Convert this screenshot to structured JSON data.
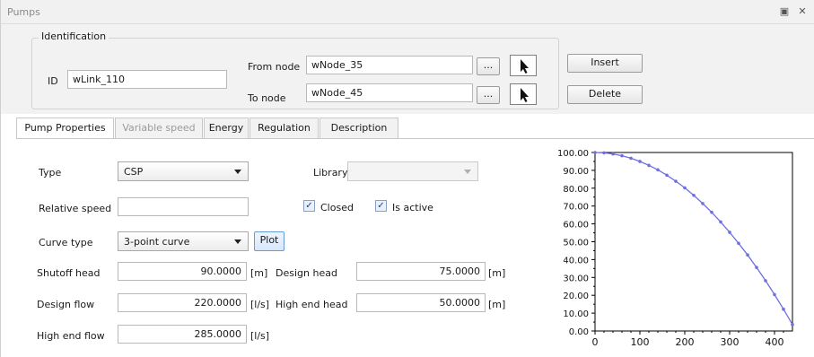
{
  "window": {
    "title": "Pumps"
  },
  "identification": {
    "legend": "Identification",
    "id_label": "ID",
    "id_value": "wLink_110",
    "from_node_label": "From node",
    "from_node_value": "wNode_35",
    "to_node_label": "To node",
    "to_node_value": "wNode_45",
    "browse_label": "...",
    "insert_label": "Insert",
    "delete_label": "Delete"
  },
  "tabs": [
    {
      "label": "Pump Properties",
      "state": "active"
    },
    {
      "label": "Variable speed",
      "state": "disabled"
    },
    {
      "label": "Energy",
      "state": "normal"
    },
    {
      "label": "Regulation",
      "state": "normal"
    },
    {
      "label": "Description",
      "state": "normal"
    }
  ],
  "properties": {
    "type_label": "Type",
    "type_value": "CSP",
    "library_label": "Library",
    "library_value": "",
    "relative_speed_label": "Relative speed",
    "relative_speed_value": "",
    "closed_label": "Closed",
    "closed_checked": true,
    "is_active_label": "Is active",
    "is_active_checked": true,
    "curve_type_label": "Curve type",
    "curve_type_value": "3-point curve",
    "plot_label": "Plot",
    "shutoff_head_label": "Shutoff head",
    "shutoff_head_value": "90.0000",
    "shutoff_head_unit": "[m]",
    "design_head_label": "Design head",
    "design_head_value": "75.0000",
    "design_head_unit": "[m]",
    "design_flow_label": "Design flow",
    "design_flow_value": "220.0000",
    "design_flow_unit": "[l/s]",
    "high_end_head_label": "High end head",
    "high_end_head_value": "50.0000",
    "high_end_head_unit": "[m]",
    "high_end_flow_label": "High end flow",
    "high_end_flow_value": "285.0000",
    "high_end_flow_unit": "[l/s]"
  },
  "colors": {
    "curve": "#6f6fe0",
    "selected_tab_text": "#1a1a1a",
    "disabled_text": "#9a9a9a"
  },
  "chart_data": {
    "type": "line",
    "title": "",
    "xlabel": "",
    "ylabel": "",
    "xlim": [
      0,
      440
    ],
    "ylim": [
      0,
      100
    ],
    "x_ticks": [
      "0",
      "100",
      "200",
      "300",
      "400"
    ],
    "x_tick_values": [
      0,
      100,
      200,
      300,
      400
    ],
    "y_ticks": [
      "0.00",
      "10.00",
      "20.00",
      "30.00",
      "40.00",
      "50.00",
      "60.00",
      "70.00",
      "80.00",
      "90.00",
      "100.00"
    ],
    "y_tick_values": [
      0,
      10,
      20,
      30,
      40,
      50,
      60,
      70,
      80,
      90,
      100
    ],
    "grid": false,
    "series": [
      {
        "values_x": [
          0,
          20,
          40,
          60,
          80,
          100,
          120,
          140,
          160,
          180,
          200,
          220,
          240,
          260,
          280,
          300,
          320,
          340,
          360,
          380,
          400,
          420,
          440
        ],
        "values_y": [
          100.0,
          99.8,
          99.2,
          98.2,
          96.8,
          95.0,
          92.8,
          90.3,
          87.3,
          83.9,
          80.2,
          76.0,
          71.4,
          66.5,
          61.1,
          55.3,
          49.1,
          42.6,
          35.6,
          28.2,
          20.4,
          12.2,
          3.6
        ]
      }
    ]
  }
}
